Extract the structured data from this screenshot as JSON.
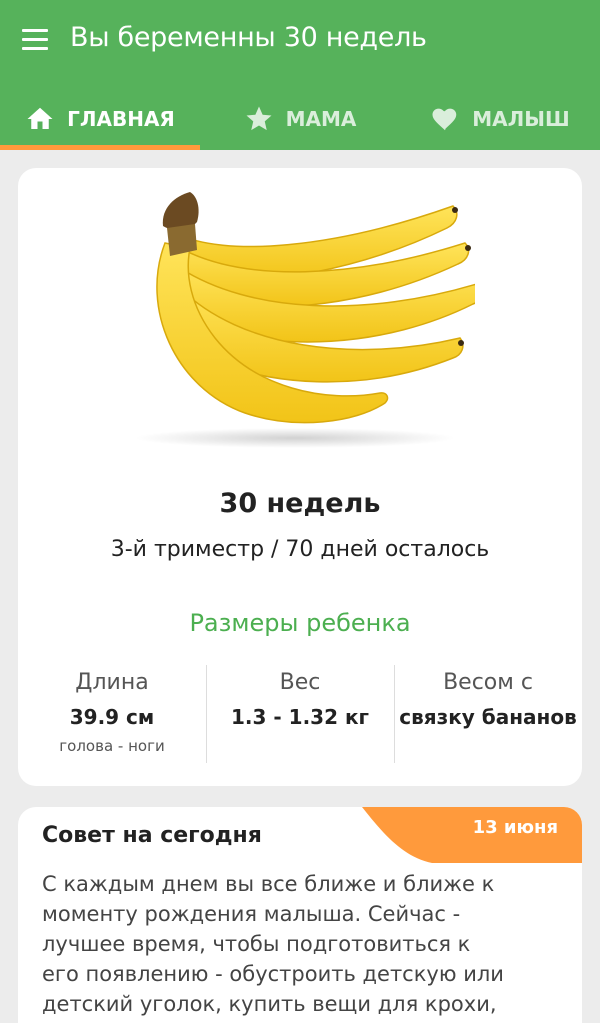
{
  "app": {
    "title": "Вы беременны 30 недель"
  },
  "tabs": [
    {
      "label": "ГЛАВНАЯ",
      "icon": "home-icon",
      "active": true
    },
    {
      "label": "МАМА",
      "icon": "star-icon",
      "active": false
    },
    {
      "label": "МАЛЫШ",
      "icon": "heart-icon",
      "active": false
    }
  ],
  "week": {
    "image": "banana-bunch-image",
    "title": "30 недель",
    "trimester": "3-й триместр / 70 дней осталось",
    "sizes_title": "Размеры ребенка",
    "stats": [
      {
        "label": "Длина",
        "value": "39.9 см",
        "sub": "голова - ноги"
      },
      {
        "label": "Вес",
        "value": "1.3 - 1.32 кг",
        "sub": ""
      },
      {
        "label": "Весом с",
        "value": "связку бананов",
        "sub": ""
      }
    ]
  },
  "tip": {
    "title": "Совет на сегодня",
    "date": "13 июня",
    "text": "С каждым днем вы все ближе и ближе к моменту рождения малыша. Сейчас - лучшее время, чтобы подготовиться к его появлению - обустроить детскую или детский уголок, купить вещи для крохи,"
  },
  "colors": {
    "primary": "#56b25b",
    "accent": "#ff9a3c",
    "sizes_title": "#4caf50"
  }
}
